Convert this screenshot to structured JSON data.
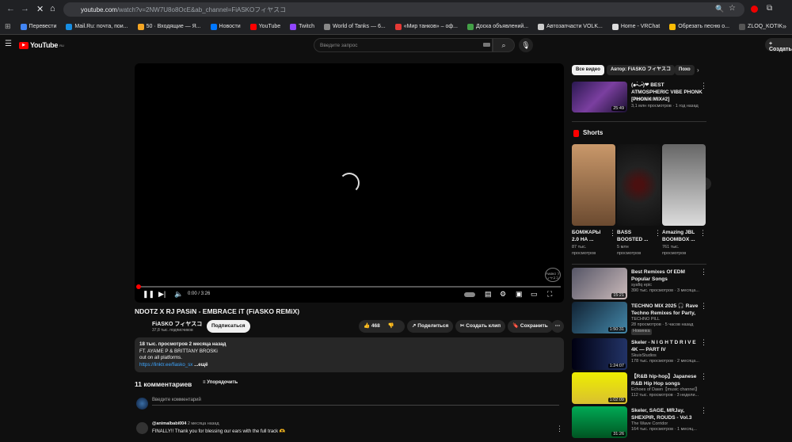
{
  "browser": {
    "url_host": "youtube.com",
    "url_path": "/watch?v=2NW7U8o8OcE&ab_channel=FiASKOフィヤスコ",
    "bookmarks": [
      {
        "label": "Перевести",
        "color": "#4285f4"
      },
      {
        "label": "Mail.Ru: почта, пои...",
        "color": "#168de2"
      },
      {
        "label": "50 · Входящие — Я...",
        "color": "#f5a623"
      },
      {
        "label": "Новости",
        "color": "#0077ff"
      },
      {
        "label": "YouTube",
        "color": "#ff0000"
      },
      {
        "label": "Twitch",
        "color": "#9146ff"
      },
      {
        "label": "World of Tanks — 6...",
        "color": "#888888"
      },
      {
        "label": "«Мир танков» – оф...",
        "color": "#e53935"
      },
      {
        "label": "Доска объявлений...",
        "color": "#43a047"
      },
      {
        "label": "Автозапчасти VOLK...",
        "color": "#cccccc"
      },
      {
        "label": "Home - VRChat",
        "color": "#dddddd"
      },
      {
        "label": "Обрезать песню о...",
        "color": "#fbbc05"
      },
      {
        "label": "ZLOQ_KOTIK",
        "color": "#555555"
      }
    ],
    "more": "»"
  },
  "header": {
    "logo": "YouTube",
    "region": "RU",
    "search_placeholder": "Введите запрос",
    "create_label": "Создать"
  },
  "player": {
    "time": "0:00 / 3:26",
    "progress": 0,
    "watermark": "FiASKO フィヤスコ"
  },
  "video": {
    "title": "NDOTZ X RJ PASiN - EMBRACE iT (FiASKO REMiX)",
    "channel": "FiASKO フィヤスコ",
    "subscribers": "37,8 тыс. подписчиков",
    "subscribe": "Подписаться",
    "likes": "468",
    "share": "Поделиться",
    "clip": "Создать клип",
    "save": "Сохранить"
  },
  "description": {
    "stats": "18 тыс. просмотров  2 месяца назад",
    "line1": "FT. AYAME P & BRITTANY BROSKi",
    "line2": "out on all platforms.",
    "link": "https://linktr.ee/fiasko_sx",
    "more": "...ещё"
  },
  "comments": {
    "count": "11 комментариев",
    "sort": "Упорядочить",
    "placeholder": "Введите комментарий",
    "items": [
      {
        "author": "@animalbabi004",
        "time": "2 месяца назад",
        "text": "FINALLY!! Thank you for blessing our ears with the full track 🫶"
      }
    ]
  },
  "sidebar": {
    "chips": [
      "Все видео",
      "Автор: FiASKO フィヤスコ",
      "Похо"
    ],
    "top_video": {
      "title": "(๑•̀ᴗ•̀)❤ BEST ATMOSPHERIC VIBE PHONK [PHONK MIX#2]",
      "channel": "PHONK MIX",
      "meta": "3,1 млн просмотров · 1 год назад",
      "duration": "25:49"
    },
    "shorts_title": "Shorts",
    "shorts": [
      {
        "title": "БОМЖАРЫ 2.0 НА ...",
        "views": "87 тыс. просмотров"
      },
      {
        "title": "BASS BOOSTED ...",
        "views": "5 млн просмотров"
      },
      {
        "title": "Amazing JBL BOOMBOX ...",
        "views": "761 тыс. просмотров"
      }
    ],
    "videos": [
      {
        "title": "Best Remixes Of EDM Popular Songs",
        "channel": "syafiq epic",
        "meta": "390 тыс. просмотров · 3 месяца...",
        "duration": "15:21",
        "badge": ""
      },
      {
        "title": "TECHNO MIX 2025 🎧 Rave Techno Remixes for Party, Gy...",
        "channel": "TECHNO PILL",
        "meta": "28 просмотров · 5 часов назад",
        "duration": "1:50:31",
        "badge": "Новинка"
      },
      {
        "title": "Skeler - N I G H T D R I V E 4K — PART IV",
        "channel": "SkuixStudios",
        "meta": "178 тыс. просмотров · 2 месяца...",
        "duration": "1:24:07",
        "badge": ""
      },
      {
        "title": "【R&B hip-hop】Japanese R&B Hip Hop songs",
        "channel": "Echoes of Dawn【music channel】",
        "meta": "112 тыс. просмотров · 3 недели...",
        "duration": "1:02:09",
        "badge": ""
      },
      {
        "title": "Skeler, SAGE, MRJay, SHEXPIR, ROUDS - Vol.3 Mix...",
        "channel": "The Wave Corridor",
        "meta": "164 тыс. просмотров · 1 месяц...",
        "duration": "31:26",
        "badge": ""
      }
    ]
  },
  "colors": {
    "accent": "#ff0000",
    "bg": "#0f0f0f",
    "surface": "#272727",
    "link": "#3ea6ff"
  }
}
